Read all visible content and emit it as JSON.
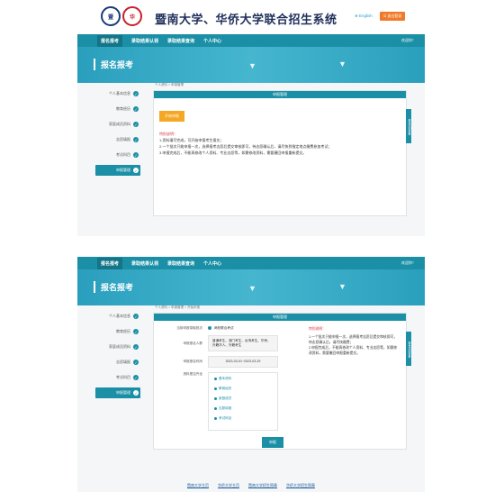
{
  "header": {
    "logo1_text": "暨",
    "logo2_text": "华",
    "title": "暨南大学、华侨大学联合招生系统",
    "lang": "⊕ English",
    "exit": "⏻ 退出登录"
  },
  "nav": {
    "items": [
      "报名报考",
      "录取结果认领",
      "录取结果查询",
      "个人中心"
    ],
    "user": "欢迎你！"
  },
  "banner": {
    "title": "报名报考"
  },
  "sidebar": {
    "items": [
      {
        "label": "个人基本信息",
        "icon": "check-icon"
      },
      {
        "label": "教育经历",
        "icon": "check-icon"
      },
      {
        "label": "家庭成员资料",
        "icon": "check-icon"
      },
      {
        "label": "志愿填报",
        "icon": "check-icon"
      },
      {
        "label": "考试科目",
        "icon": "check-icon"
      },
      {
        "label": "申报管理",
        "icon": "check-icon"
      }
    ]
  },
  "screen1": {
    "breadcrumb": "个人资料 > 申报管理",
    "panel_title": "申报管理",
    "side_tab": "报考须知查看",
    "start_button": "开始申报",
    "notes_title": "特别说明：",
    "notes": [
      "1.资料填写完成，可开始申报考生报名；",
      "2.一个批次只能申报一次，选择报考志愿后提交审核即可，待志愿确认后，请尽快到指定地点缴费参加考试；",
      "3.申报完成后，不能再修改个人资料、专业志愿等，如需修改资料，需要撤回申报重新提交。"
    ]
  },
  "screen2": {
    "breadcrumb": "个人资料 > 申报管理 > 开始申报",
    "panel_title": "申报管理",
    "side_tab": "报考须知查看",
    "rows": {
      "batch_label": "当前申报录取批次",
      "batch_value": "两校联合考试",
      "type_label": "申报报名人群",
      "type_value": "普通考生、澳门考生、台湾考生、华侨、外籍华人、外籍考生",
      "date_label": "申报报名时间",
      "date_value": "2023-03-01~2023-03-29",
      "materials_label": "资料是否齐全"
    },
    "materials": [
      "基本资料",
      "教育经历",
      "家庭成员",
      "志愿填报",
      "考试科目"
    ],
    "confirm_button": "申报",
    "notes_title": "特别说明：",
    "notes": [
      "1.一个批次只能申报一次，选择报考志愿后提交审核即可，待志愿确认后，请尽快缴费；",
      "2.申报完成后，不能再修改个人资料、专业志愿等，如需修改资料，需要撤回申报重新提交。"
    ]
  },
  "footer": {
    "links": [
      "暨南大学主页",
      "华侨大学主页",
      "暨南大学招生简章",
      "华侨大学招生简章"
    ]
  },
  "colors": {
    "accent": "#1b8fa6",
    "orange": "#f5a623",
    "red": "#d9343f"
  }
}
